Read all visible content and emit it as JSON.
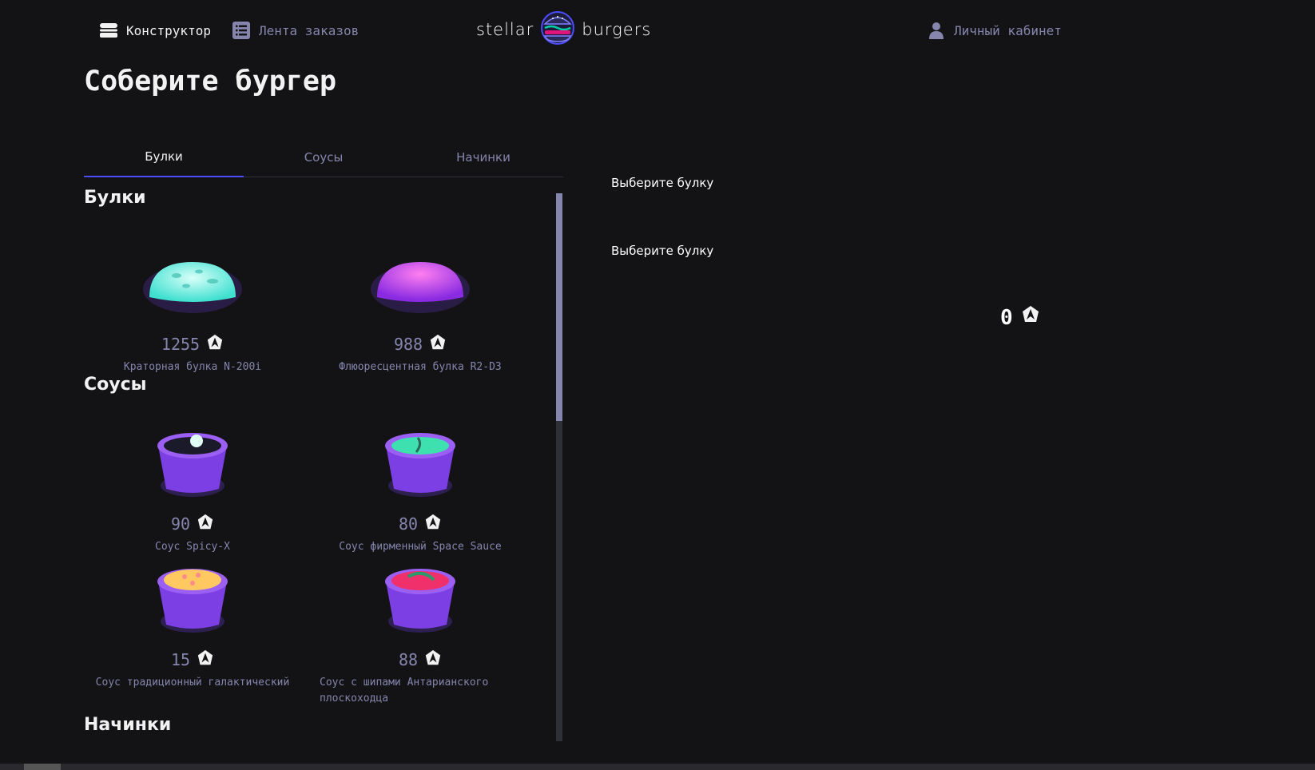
{
  "header": {
    "constructor_label": "Конструктор",
    "feed_label": "Лента заказов",
    "logo_left": "stellar",
    "logo_right": "burgers",
    "account_label": "Личный кабинет"
  },
  "page_title": "Соберите бургер",
  "tabs": [
    {
      "label": "Булки"
    },
    {
      "label": "Соусы"
    },
    {
      "label": "Начинки"
    }
  ],
  "sections": {
    "buns": {
      "title": "Булки",
      "items": [
        {
          "price": "1255",
          "name": "Краторная булка N-200i"
        },
        {
          "price": "988",
          "name": "Флюоресцентная булка R2-D3"
        }
      ]
    },
    "sauces": {
      "title": "Соусы",
      "items": [
        {
          "price": "90",
          "name": "Соус Spicy-X"
        },
        {
          "price": "80",
          "name": "Соус фирменный Space Sauce"
        },
        {
          "price": "15",
          "name": "Соус традиционный галактический"
        },
        {
          "price": "88",
          "name": "Соус с шипами Антарианского плоскоходца"
        }
      ]
    },
    "fillings": {
      "title": "Начинки"
    }
  },
  "constructor": {
    "top_placeholder": "Выберите булку",
    "bottom_placeholder": "Выберите булку",
    "total": "0"
  },
  "colors": {
    "background": "#131316",
    "accent": "#4c4cff",
    "inactive": "#8585ad"
  }
}
